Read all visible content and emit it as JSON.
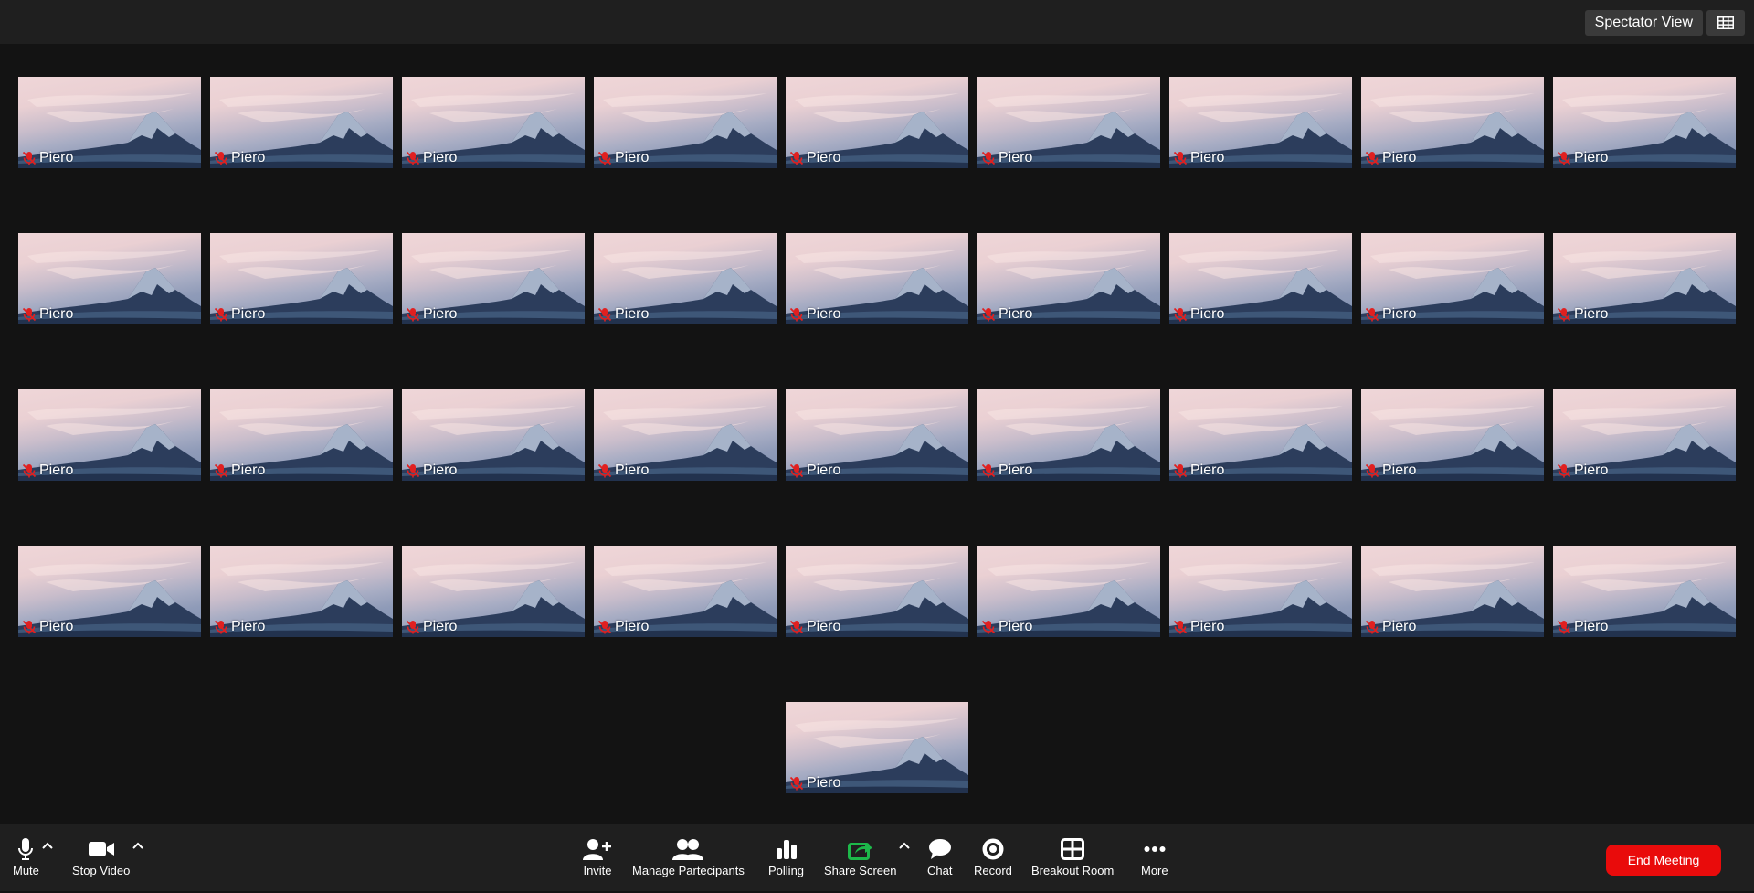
{
  "topbar": {
    "spectator_view_label": "Spectator View",
    "grid_icon": "grid-icon"
  },
  "gallery": {
    "participant_name": "Piero",
    "participant_count": 37,
    "muted_icon": "mic-muted-icon"
  },
  "toolbar": {
    "mute_label": "Mute",
    "stop_video_label": "Stop Video",
    "invite_label": "Invite",
    "manage_participants_label": "Manage Partecipants",
    "polling_label": "Polling",
    "share_screen_label": "Share Screen",
    "chat_label": "Chat",
    "record_label": "Record",
    "breakout_room_label": "Breakout Room",
    "more_label": "More",
    "end_meeting_label": "End Meeting"
  },
  "colors": {
    "background": "#131313",
    "bar": "#1f1f1f",
    "share_green": "#1db94a",
    "end_red": "#e90b0b",
    "muted_red": "#e02020"
  }
}
